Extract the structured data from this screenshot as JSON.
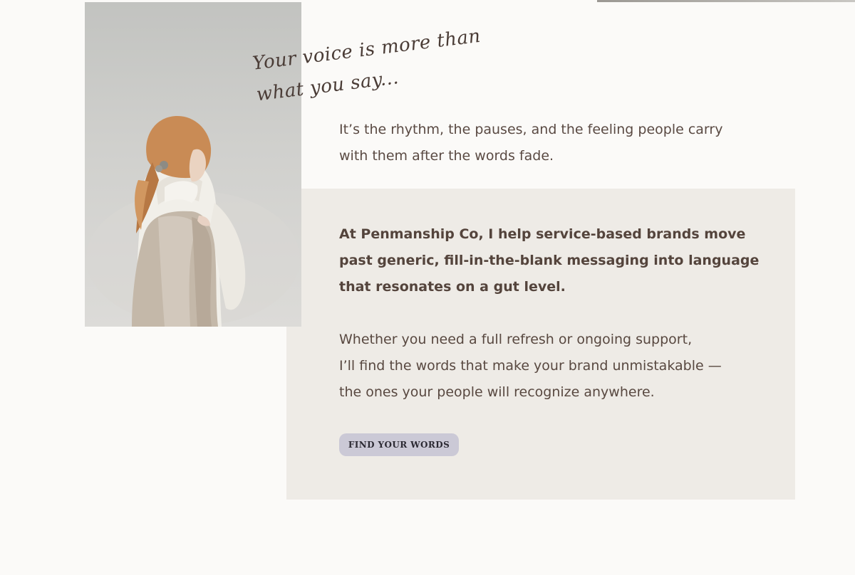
{
  "hero": {
    "tagline_lines": [
      "Your voice is more than",
      "what you say..."
    ],
    "intro_lines": [
      "It’s the rhythm, the pauses, and the feeling people carry",
      "with them after the words fade."
    ]
  },
  "about": {
    "paragraph_1_lines": [
      "At Penmanship Co, I help service-based brands move",
      "past generic, fill-in-the-blank messaging into language",
      "that resonates on a gut level."
    ],
    "paragraph_2_lines": [
      "Whether you need a full refresh or ongoing support,",
      "I’ll find the words that make your brand unmistakable —",
      "the ones your people will recognize anywhere."
    ],
    "cta_label": "FIND YOUR WORDS"
  },
  "colors": {
    "page_background": "#fbfaf8",
    "panel_background": "#eeebe6",
    "text": "#584840",
    "button_background": "#cbc9d6",
    "button_text": "#2c2a33"
  }
}
